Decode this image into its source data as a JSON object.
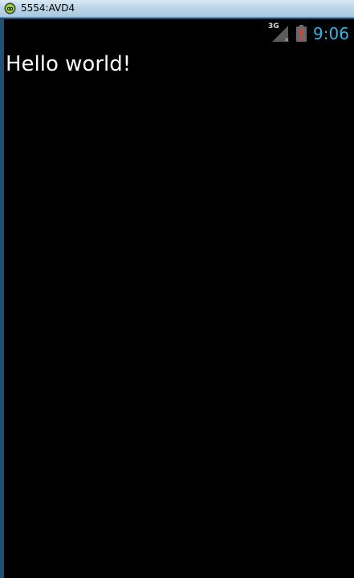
{
  "window": {
    "title": "5554:AVD4",
    "icon": "android-emulator-icon"
  },
  "statusbar": {
    "network_type": "3G",
    "signal_icon": "no-signal-icon",
    "battery_icon": "battery-alert-icon",
    "time": "9:06",
    "clock_color": "#33b5e5"
  },
  "app": {
    "text": "Hello world!"
  },
  "colors": {
    "screen_background": "#000000",
    "text": "#ffffff",
    "battery_alert": "#e53935"
  }
}
